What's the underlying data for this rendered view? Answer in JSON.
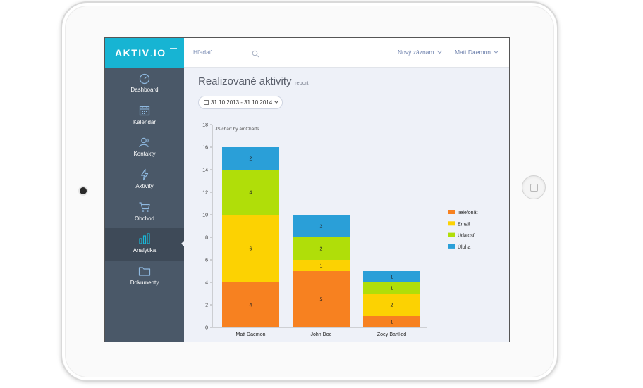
{
  "sidebar": {
    "brand": "AKTIV",
    "brand_dot": ".",
    "brand_suffix": "IO",
    "items": [
      {
        "label": "Dashboard",
        "icon": "gauge-icon"
      },
      {
        "label": "Kalendár",
        "icon": "calendar-icon"
      },
      {
        "label": "Kontakty",
        "icon": "contacts-icon"
      },
      {
        "label": "Aktivity",
        "icon": "lightning-icon"
      },
      {
        "label": "Obchod",
        "icon": "cart-icon"
      },
      {
        "label": "Analytika",
        "icon": "bar-chart-icon",
        "active": true
      },
      {
        "label": "Dokumenty",
        "icon": "folder-icon"
      }
    ]
  },
  "topbar": {
    "search_placeholder": "Hľadať...",
    "new_record": "Nový záznam",
    "user": "Matt Daemon"
  },
  "page": {
    "title": "Realizované aktivity",
    "subtitle": "report",
    "date_range": "31.10.2013 - 31.10.2014"
  },
  "chart_data": {
    "type": "bar",
    "stacked": true,
    "credit": "JS chart by amCharts",
    "categories": [
      "Matt Daemon",
      "John Doe",
      "Zoey Bartlied"
    ],
    "series": [
      {
        "name": "Telefonát",
        "color": "#f78120",
        "values": [
          4,
          5,
          1
        ]
      },
      {
        "name": "Email",
        "color": "#fcd202",
        "values": [
          6,
          1,
          2
        ]
      },
      {
        "name": "Udalosť",
        "color": "#b0de09",
        "values": [
          4,
          2,
          1
        ]
      },
      {
        "name": "Úloha",
        "color": "#2a9fd8",
        "values": [
          2,
          2,
          1
        ]
      }
    ],
    "ylim": [
      0,
      18
    ],
    "yticks": [
      0,
      2,
      4,
      6,
      8,
      10,
      12,
      14,
      16,
      18
    ],
    "legend": "right"
  },
  "colors": {
    "brand": "#17b4d3",
    "sidebar": "#4a5868",
    "content_bg": "#eef1f8"
  }
}
